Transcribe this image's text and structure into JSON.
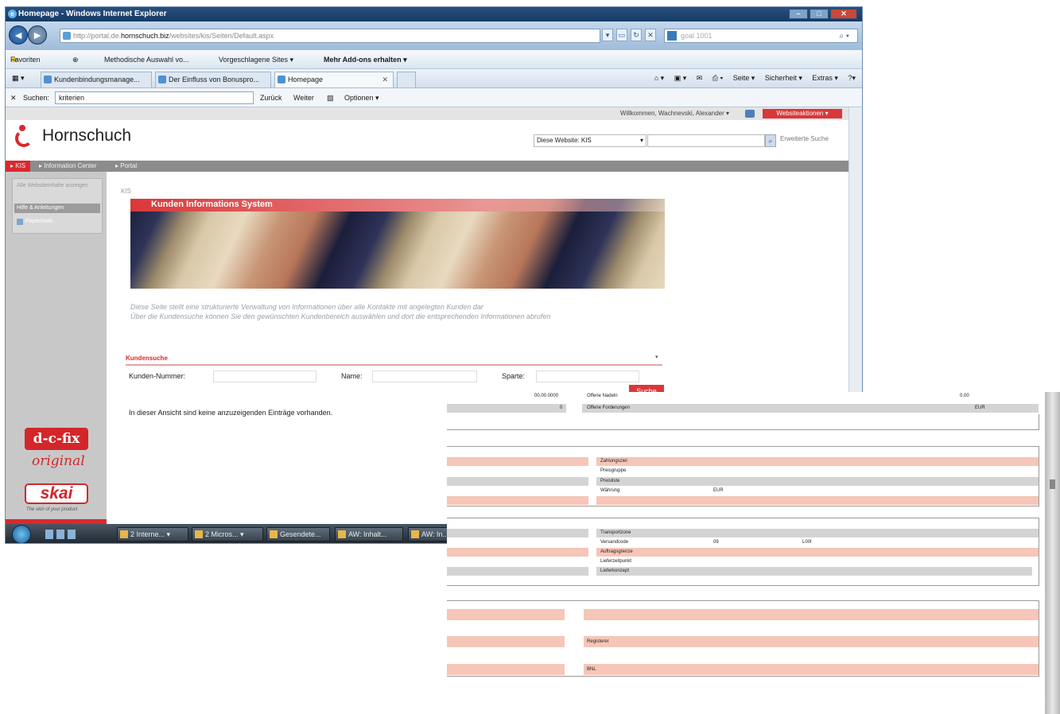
{
  "window": {
    "title": "Homepage - Windows Internet Explorer",
    "url_prefix": "http://portal.de.",
    "url_host": "hornschuch.biz",
    "url_path": "/websites/kis/Seiten/Default.aspx",
    "search_engine": "goal 1001",
    "favorites_label": "Favoriten",
    "fav_links": [
      "Methodische Auswahl vo...",
      "Vorgeschlagene Sites ▾",
      "Mehr Add-ons erhalten ▾"
    ],
    "tabs": [
      "Kundenbindungsmanage...",
      "Der Einfluss von Bonuspro...",
      "Homepage"
    ],
    "cmd": [
      "Seite ▾",
      "Sicherheit ▾",
      "Extras ▾"
    ],
    "find": {
      "label": "Suchen:",
      "value": "kriterien",
      "back": "Zurück",
      "next": "Weiter",
      "options": "Optionen ▾"
    }
  },
  "site": {
    "welcome": "Willkommen, Wachnevski, Alexander ▾",
    "site_actions": "Websiteaktionen ▾",
    "logo": "Hornschuch",
    "scope": "Diese Website: KIS",
    "advanced_search": "Erweiterte Suche",
    "topnav": [
      "KIS",
      "Information Center",
      "Portal"
    ],
    "quicklaunch": {
      "item1": "Alle Websiteinhalte anzeigen",
      "item2": "Hilfe & Anleitungen",
      "item3": "Papierkorb"
    },
    "brand1": "d-c-fix",
    "brand1_sub": "original",
    "brand2": "skai",
    "brand2_tag": "The skin of your product"
  },
  "content": {
    "breadcrumb": "KIS",
    "banner_title": "Kunden Informations System",
    "intro": [
      "Diese Seite stellt eine strukturierte Verwaltung von Informationen über alle Kontakte mit angelegten Kunden dar",
      "Über die Kundensuche können Sie den gewünschten Kundenbereich auswählen und dort die entsprechenden Informationen abrufen"
    ],
    "search_title": "Kundensuche",
    "fields": {
      "kunden_nummer": "Kunden-Nummer:",
      "name": "Name:",
      "sparte": "Sparte:"
    },
    "search_button": "Suche",
    "empty_message": "In dieser Ansicht sind keine anzuzeigenden Einträge vorhanden."
  },
  "taskbar": [
    "2 Interne... ▾",
    "2 Micros... ▾",
    "Gesendete...",
    "AW: Inhalt...",
    "AW: In..."
  ],
  "overlay": {
    "top_date": "00.00.0000",
    "offene_nadeln": "Offene Nadeln",
    "offene_nadeln_val": "0.00",
    "small_zero": "0",
    "offene_forderungen": "Offene Forderungen",
    "eur1": "EUR",
    "zahlungsziel": "Zahlungsziel",
    "preisgruppe": "Preisgruppe",
    "preisliste": "Preisliste",
    "waehrung": "Währung",
    "eur2": "EUR",
    "transportzone": "Transportzone",
    "versandcode": "Versandcode",
    "versandcode_v1": "09",
    "versandcode_v2": "L00I",
    "auftragsgrenze": "Auftragsgrenze",
    "lieferzeitpunkt": "Lieferzeitpunkt",
    "lieferkonzept": "Lieferkonzept",
    "registerer": "Registerer",
    "bnl": "BNL"
  }
}
